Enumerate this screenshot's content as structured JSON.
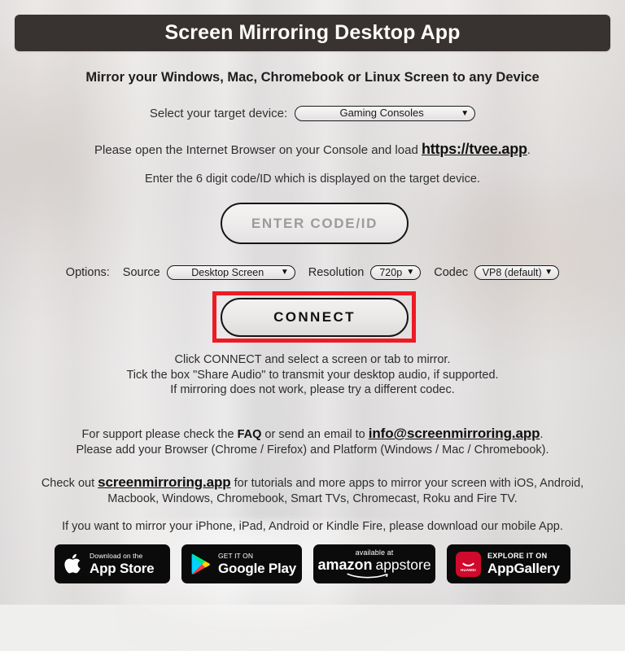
{
  "header": {
    "title": "Screen Mirroring Desktop App"
  },
  "subtitle": "Mirror your Windows, Mac, Chromebook or Linux Screen to any Device",
  "device": {
    "label": "Select your target device:",
    "selected": "Gaming Consoles",
    "options": [
      "Gaming Consoles"
    ]
  },
  "load_line": {
    "prefix": "Please open the Internet Browser on your Console and load ",
    "url": "https://tvee.app",
    "suffix": "."
  },
  "code_hint": "Enter the 6 digit code/ID which is displayed on the target device.",
  "code_input": {
    "placeholder": "ENTER CODE/ID",
    "value": ""
  },
  "options": {
    "label": "Options:",
    "source_label": "Source",
    "source_selected": "Desktop Screen",
    "source_options": [
      "Desktop Screen"
    ],
    "resolution_label": "Resolution",
    "resolution_selected": "720p",
    "resolution_options": [
      "720p"
    ],
    "codec_label": "Codec",
    "codec_selected": "VP8 (default)",
    "codec_options": [
      "VP8 (default)"
    ]
  },
  "connect": {
    "label": "CONNECT",
    "highlight_color": "#ed1b24"
  },
  "instructions": {
    "line1": "Click CONNECT and select a screen or tab to mirror.",
    "line2": "Tick the box \"Share Audio\" to transmit your desktop audio, if supported.",
    "line3": "If mirroring does not work, please try a different codec."
  },
  "support": {
    "prefix": "For support please check the ",
    "faq": "FAQ",
    "middle": " or send an email to ",
    "email": "info@screenmirroring.app",
    "suffix": ".",
    "line2": "Please add your Browser (Chrome / Firefox) and Platform (Windows / Mac / Chromebook)."
  },
  "checkout": {
    "prefix": "Check out ",
    "site": "screenmirroring.app",
    "suffix": " for tutorials and more apps to mirror your screen with iOS, Android,",
    "line2": "Macbook, Windows, Chromebook, Smart TVs, Chromecast, Roku and Fire TV."
  },
  "mobile_line": "If you want to mirror your iPhone, iPad, Android or Kindle Fire, please download our mobile App.",
  "badges": {
    "appstore": {
      "small": "Download on the",
      "big": "App Store",
      "icon": "apple-icon"
    },
    "googleplay": {
      "small": "GET IT ON",
      "big": "Google Play",
      "icon": "google-play-icon"
    },
    "amazon": {
      "small": "available at",
      "big_bold": "amazon",
      "big_reg": "appstore",
      "icon": "amazon-smile-icon"
    },
    "appgallery": {
      "small": "EXPLORE IT ON",
      "big": "AppGallery",
      "icon": "huawei-icon",
      "brand": "HUAWEI",
      "brand_color": "#cf0a2c"
    }
  },
  "theme": {
    "header_bg": "#383230",
    "page_text": "#2d2d2d",
    "highlight_red": "#ed1b24"
  }
}
